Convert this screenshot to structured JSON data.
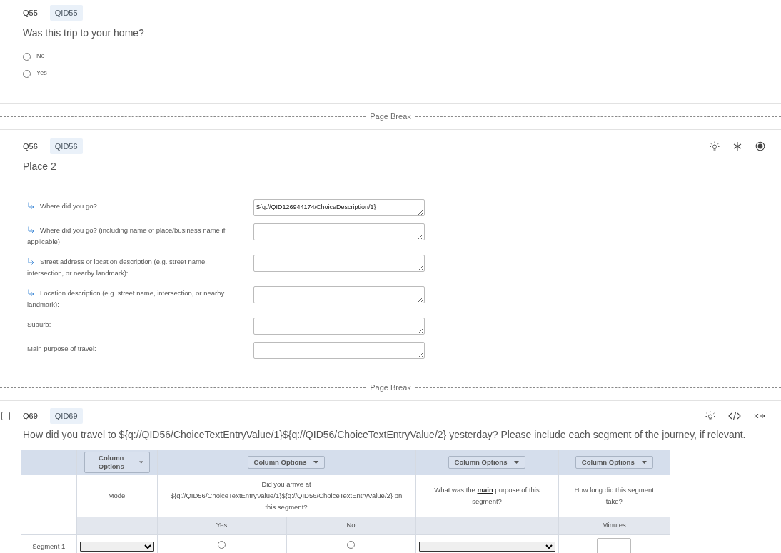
{
  "q55": {
    "number": "Q55",
    "id": "QID55",
    "text": "Was this trip to your home?",
    "choices": [
      {
        "label": "No",
        "selected": false
      },
      {
        "label": "Yes",
        "selected": false
      }
    ]
  },
  "page_break_1": {
    "label": "Page Break"
  },
  "q56": {
    "number": "Q56",
    "id": "QID56",
    "text": "Place 2",
    "tools": [
      {
        "kind": "hint"
      },
      {
        "kind": "required"
      },
      {
        "kind": "target"
      }
    ],
    "fields": [
      {
        "label": "Where did you go?",
        "carry_forward": true,
        "value": "${q://QID126944174/ChoiceDescription/1}"
      },
      {
        "label": "Where did you go? (including name of place/business name if applicable)",
        "carry_forward": true
      },
      {
        "label": "Street address or location description (e.g. street name, intersection, or nearby landmark):",
        "carry_forward": true
      },
      {
        "label": "Location description (e.g. street name, intersection, or nearby landmark):",
        "carry_forward": true
      },
      {
        "label": "Suburb:",
        "carry_forward": false
      },
      {
        "label": "Main purpose of travel:",
        "carry_forward": false
      }
    ]
  },
  "page_break_2": {
    "label": "Page Break"
  },
  "q69": {
    "number": "Q69",
    "id": "QID69",
    "checked": false,
    "text": "How did you travel to ${q://QID56/ChoiceTextEntryValue/1}${q://QID56/ChoiceTextEntryValue/2} yesterday? Please include each segment of the journey, if relevant.",
    "tools": [
      {
        "kind": "hint"
      },
      {
        "kind": "code"
      },
      {
        "kind": "skip"
      }
    ],
    "matrix": {
      "columns": [
        {
          "kind": "dropdown",
          "options_button": "Column Options",
          "question": "Mode"
        },
        {
          "kind": "radio",
          "options_button": "Column Options",
          "question": "Did you arrive at ${q://QID56/ChoiceTextEntryValue/1}${q://QID56/ChoiceTextEntryValue/2} on this segment?",
          "choices": [
            "Yes",
            "No"
          ]
        },
        {
          "kind": "dropdown",
          "options_button": "Column Options",
          "question": "What was the **main** purpose of this segment?"
        },
        {
          "kind": "text",
          "options_button": "Column Options",
          "question": "How long did this segment take?",
          "choices": [
            "Minutes"
          ]
        }
      ],
      "rows": [
        {
          "label": "Segment 1",
          "radios": [
            {
              "selected": false
            },
            {
              "selected": false
            }
          ]
        }
      ]
    }
  }
}
